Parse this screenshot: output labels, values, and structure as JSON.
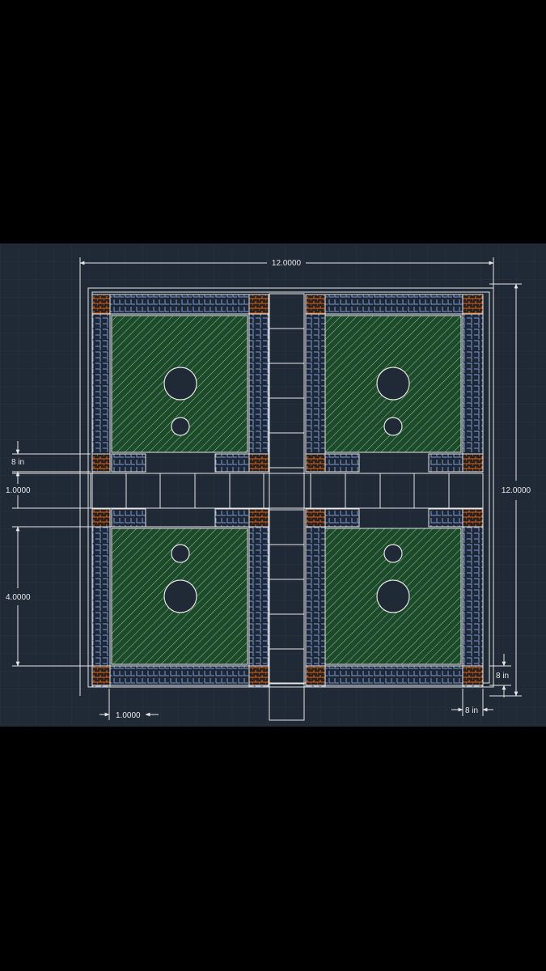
{
  "colors": {
    "canvas": "#202936",
    "grid": "#2b3442",
    "line": "#e6e6e6",
    "hatch_fill": "#1d4a2a",
    "hatch_line": "#8fc49a",
    "block_blue": "#7f9cd6",
    "block_orange": "#d36a2a",
    "dimension_text": "#e8e8e8"
  },
  "dimensions": {
    "overall_width": "12.0000",
    "overall_height": "12.0000",
    "row_gap_top": "8  in",
    "path_width": "1.0000",
    "plot_height": "4.0000",
    "bottom_offset": "8 in",
    "left_offset": "1.0000",
    "corner_offset": "8 in"
  },
  "icons": [
    "dimension-arrow-icon",
    "hatch-pattern",
    "circle-hole"
  ]
}
